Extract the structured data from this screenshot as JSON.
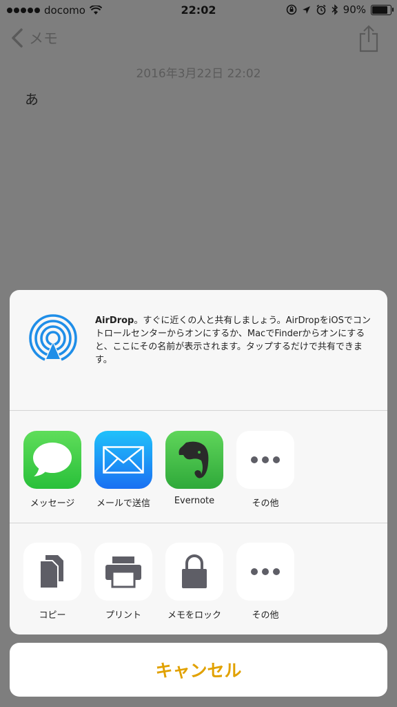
{
  "status_bar": {
    "carrier": "docomo",
    "time": "22:02",
    "battery_percent": "90%",
    "battery_level": 0.9
  },
  "nav": {
    "back_label": "メモ"
  },
  "note": {
    "date": "2016年3月22日 22:02",
    "body": "あ"
  },
  "airdrop": {
    "title": "AirDrop",
    "description": "。すぐに近くの人と共有しましょう。AirDropをiOSでコントロールセンターからオンにするか、MacでFinderからオンにすると、ここにその名前が表示されます。タップするだけで共有できます。"
  },
  "share_apps": [
    {
      "label": "メッセージ",
      "icon": "messages-icon"
    },
    {
      "label": "メールで送信",
      "icon": "mail-icon"
    },
    {
      "label": "Evernote",
      "icon": "evernote-icon"
    },
    {
      "label": "その他",
      "icon": "more-icon"
    }
  ],
  "actions": [
    {
      "label": "コピー",
      "icon": "copy-icon"
    },
    {
      "label": "プリント",
      "icon": "print-icon"
    },
    {
      "label": "メモをロック",
      "icon": "lock-icon"
    },
    {
      "label": "その他",
      "icon": "more-icon"
    }
  ],
  "cancel_label": "キャンセル",
  "colors": {
    "accent": "#e1a100",
    "messages_green": "#3fc94a",
    "mail_blue": "#1e7ff5",
    "evernote_green": "#3fb53f",
    "airdrop_blue": "#1f8ee8",
    "action_gray": "#5e5e66"
  }
}
